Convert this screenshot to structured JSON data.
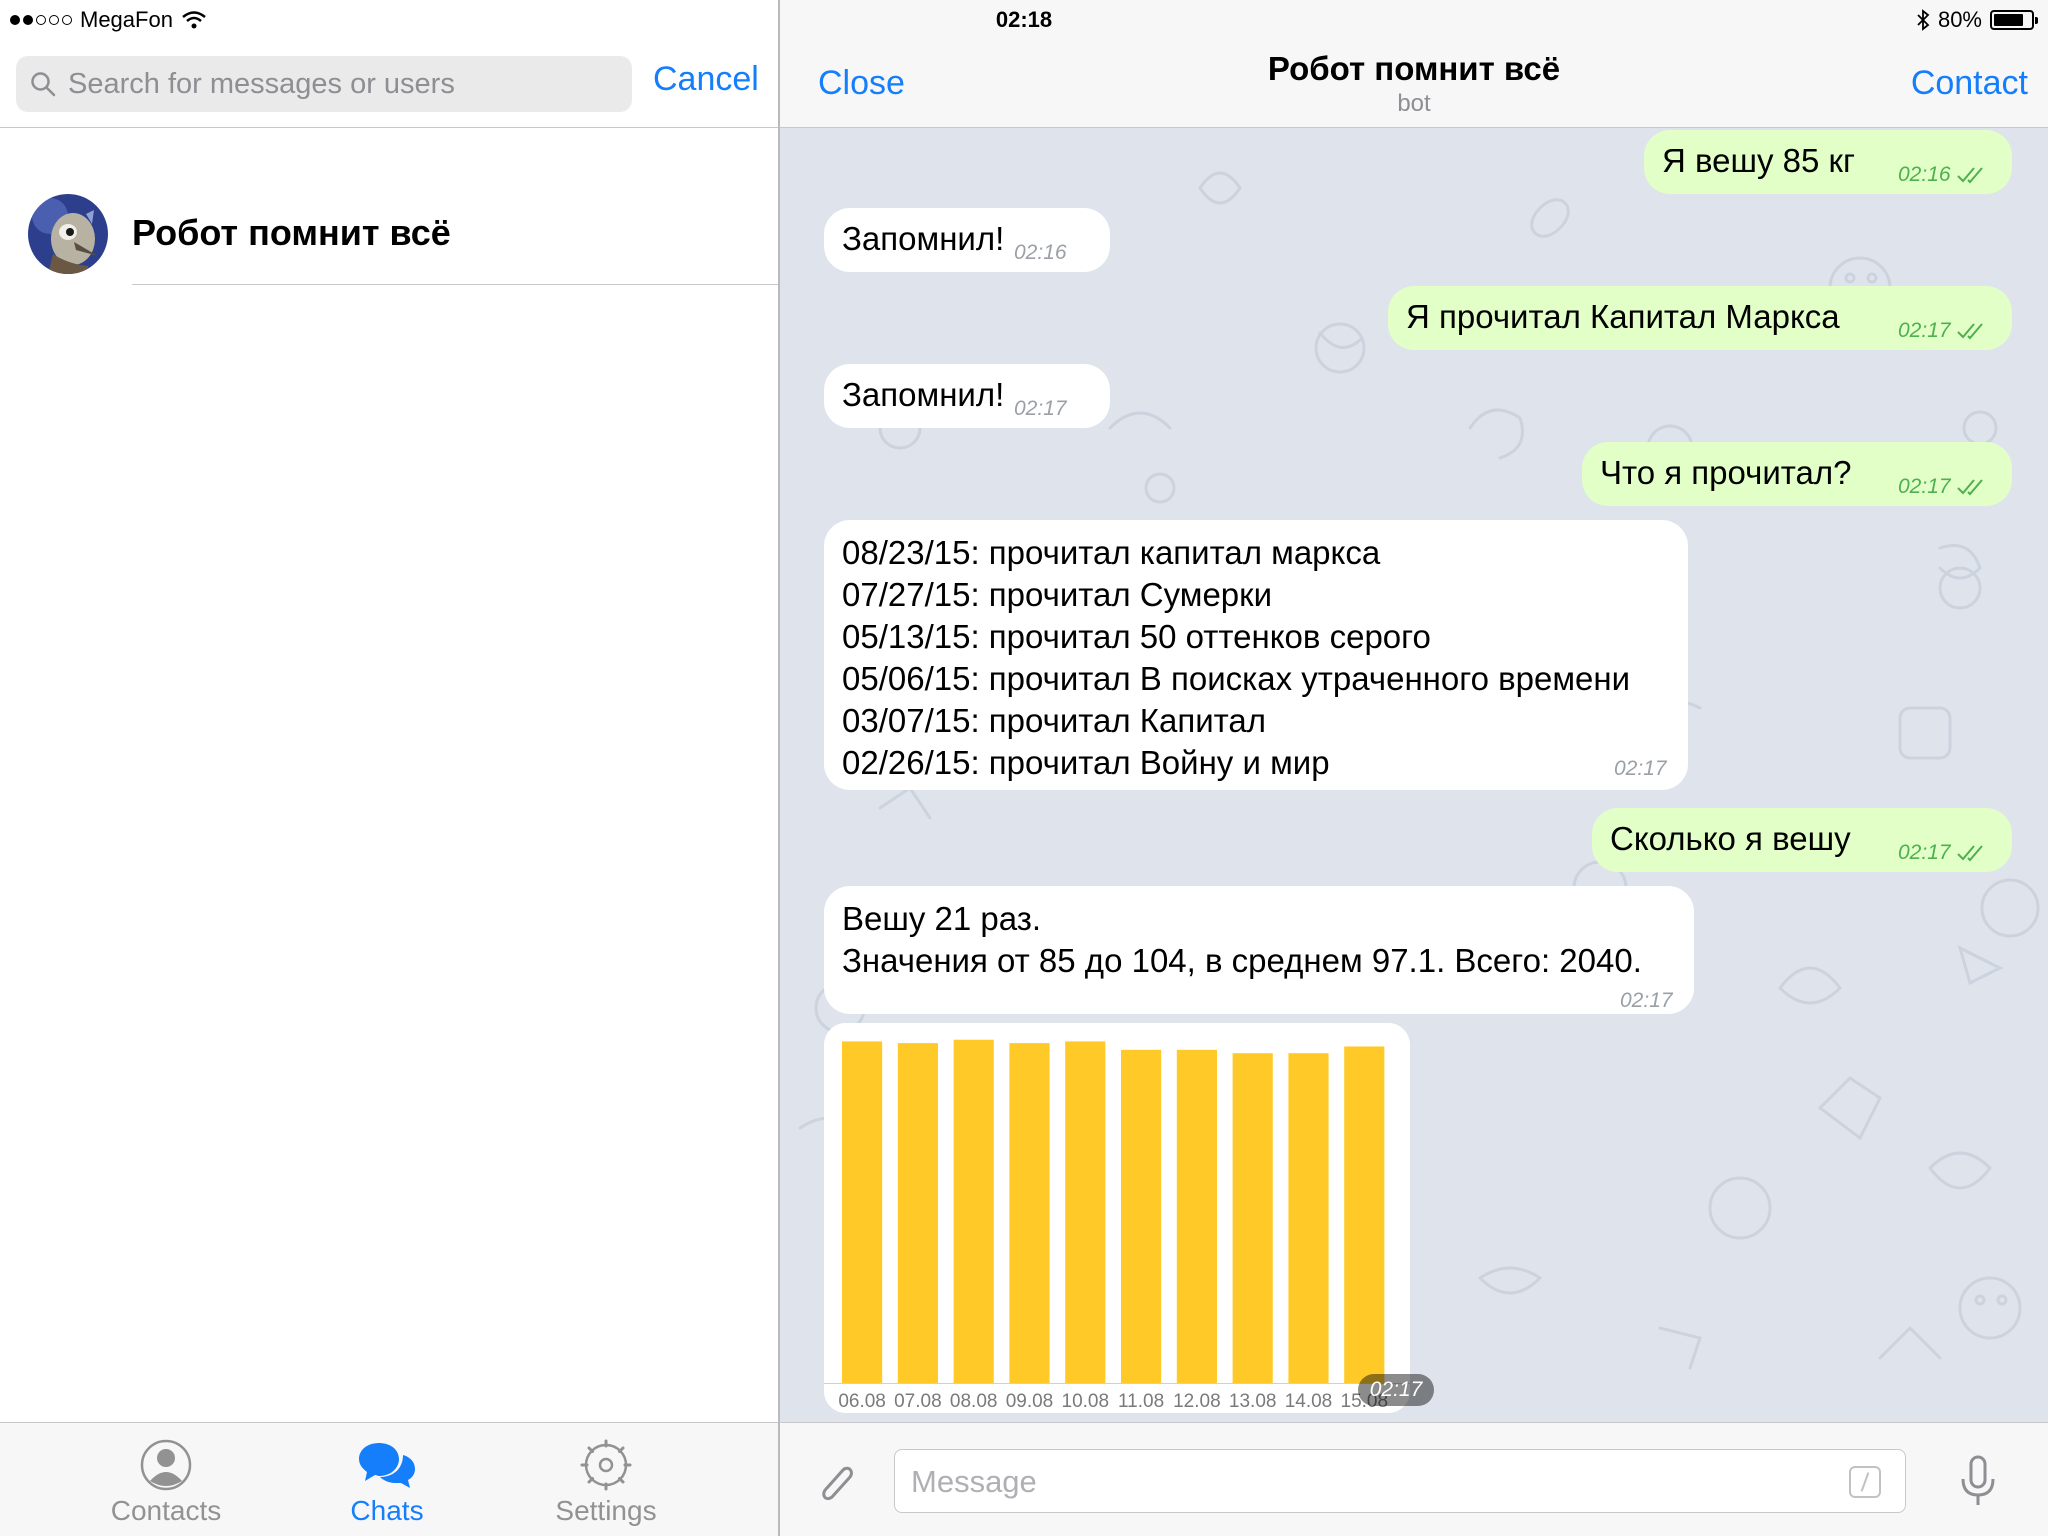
{
  "status": {
    "carrier": "MegaFon",
    "time": "02:18",
    "battery": "80%",
    "battery_level": 0.8
  },
  "search": {
    "placeholder": "Search for messages or users",
    "cancel_label": "Cancel"
  },
  "chat_list": {
    "items": [
      {
        "title": "Робот помнит всё"
      }
    ]
  },
  "tabs": [
    {
      "label": "Contacts"
    },
    {
      "label": "Chats"
    },
    {
      "label": "Settings"
    }
  ],
  "chat": {
    "title": "Робот помнит всё",
    "subtitle": "bot",
    "close_label": "Close",
    "contact_label": "Contact"
  },
  "messages": [
    {
      "dir": "out",
      "text": "Я вешу 85 кг",
      "time": "02:16"
    },
    {
      "dir": "in",
      "text": "Запомнил!",
      "time": "02:16"
    },
    {
      "dir": "out",
      "text": "Я прочитал Капитал Маркса",
      "time": "02:17"
    },
    {
      "dir": "in",
      "text": "Запомнил!",
      "time": "02:17"
    },
    {
      "dir": "out",
      "text": "Что я прочитал?",
      "time": "02:17"
    },
    {
      "dir": "in",
      "lines": [
        "08/23/15: прочитал капитал маркса",
        "07/27/15: прочитал Сумерки",
        "05/13/15: прочитал 50 оттенков серого",
        "05/06/15: прочитал В поисках утраченного времени",
        "03/07/15: прочитал Капитал",
        "02/26/15: прочитал Войну и мир"
      ],
      "time": "02:17"
    },
    {
      "dir": "out",
      "text": "Сколько я вешу",
      "time": "02:17"
    },
    {
      "dir": "in",
      "lines": [
        "Вешу 21 раз.",
        "Значения от 85 до 104, в среднем 97.1. Всего: 2040."
      ],
      "time": "02:17"
    }
  ],
  "chart_data": {
    "type": "bar",
    "categories": [
      "06.08",
      "07.08",
      "08.08",
      "09.08",
      "10.08",
      "11.08",
      "12.08",
      "13.08",
      "14.08",
      "15.08"
    ],
    "values": [
      101.5,
      101,
      102,
      101,
      101.5,
      99,
      99,
      98,
      98,
      100
    ],
    "ylim": [
      0,
      104
    ],
    "color": "#ffca28",
    "time": "02:17"
  },
  "composer": {
    "placeholder": "Message"
  }
}
